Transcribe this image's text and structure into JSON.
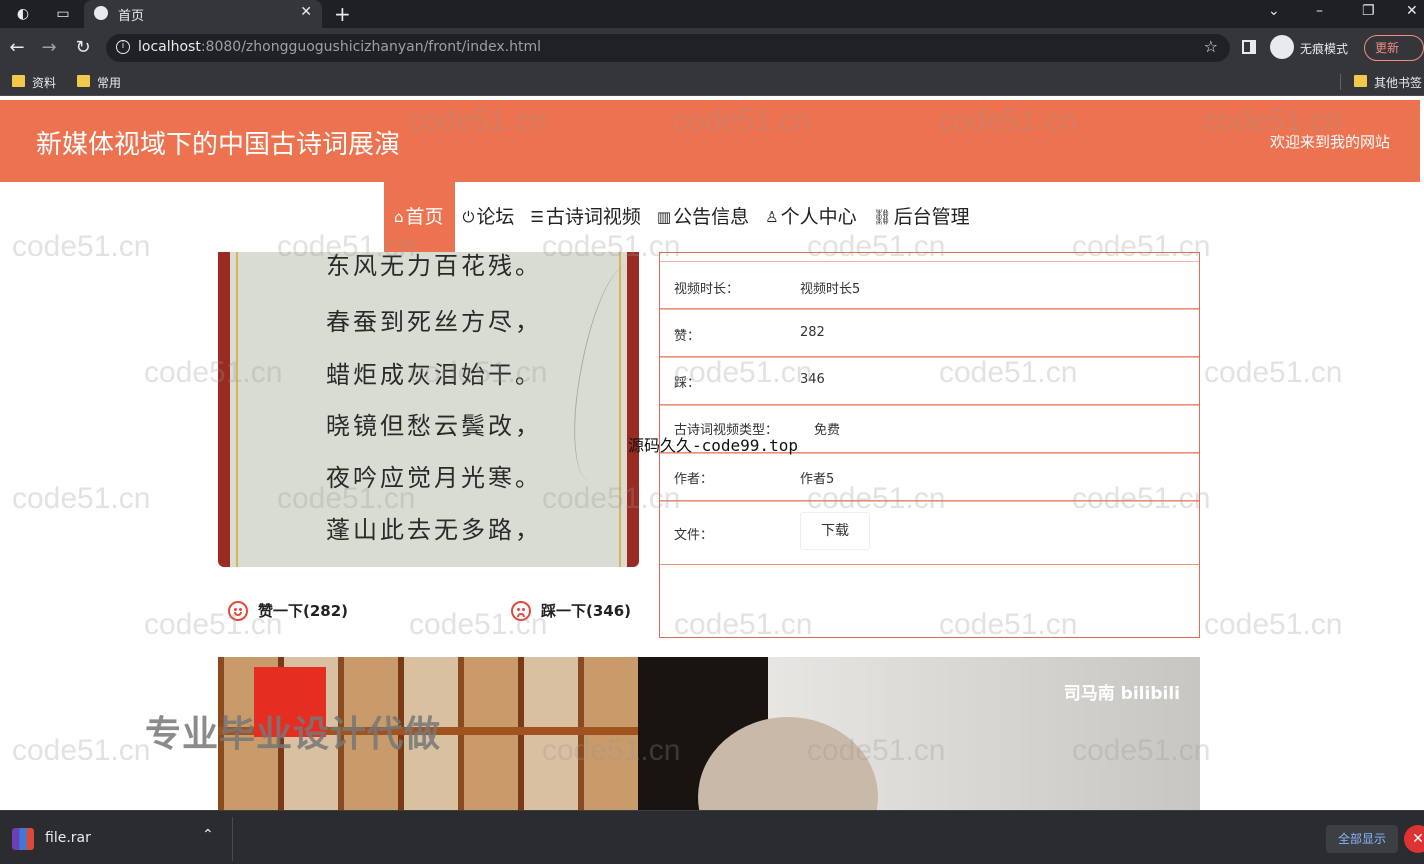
{
  "browser": {
    "tab_title": "首页",
    "url_host": "localhost",
    "url_path": ":8080/zhongguogushicizhanyan/front/index.html",
    "incognito_label": "无痕模式",
    "update_label": "更新",
    "bookmarks": [
      "资料",
      "常用"
    ],
    "other_bookmarks": "其他书签"
  },
  "header": {
    "title": "新媒体视域下的中国古诗词展演",
    "welcome": "欢迎来到我的网站"
  },
  "nav": [
    {
      "icon": "home-icon",
      "label": "首页"
    },
    {
      "icon": "power-icon",
      "label": "论坛"
    },
    {
      "icon": "layers-icon",
      "label": "古诗词视频"
    },
    {
      "icon": "book-icon",
      "label": "公告信息"
    },
    {
      "icon": "user-icon",
      "label": "个人中心"
    },
    {
      "icon": "link-icon",
      "label": "后台管理"
    }
  ],
  "poem_lines": [
    "东风无力百花残。",
    "春蚕到死丝方尽，",
    "蜡炬成灰泪始干。",
    "晓镜但愁云鬓改，",
    "夜吟应觉月光寒。",
    "蓬山此去无多路，"
  ],
  "votes": {
    "like": "赞一下(282)",
    "dislike": "踩一下(346)"
  },
  "details": [
    {
      "key": "视频时长：",
      "value": "视频时长5"
    },
    {
      "key": "赞：",
      "value": "282"
    },
    {
      "key": "踩：",
      "value": "346"
    },
    {
      "key": "古诗词视频类型：",
      "value": "免费"
    },
    {
      "key": "作者：",
      "value": "作者5"
    },
    {
      "key": "文件：",
      "value": "下载"
    }
  ],
  "overlay_text": "源码久久-code99.top",
  "video": {
    "watermark": "司马南 bilibili",
    "ad_text": "专业毕业设计代做"
  },
  "watermark_text": "code51.cn",
  "download_bar": {
    "file_name": "file.rar",
    "show_all": "全部显示"
  },
  "colors": {
    "accent": "#ed7350",
    "border": "#e06a55"
  }
}
